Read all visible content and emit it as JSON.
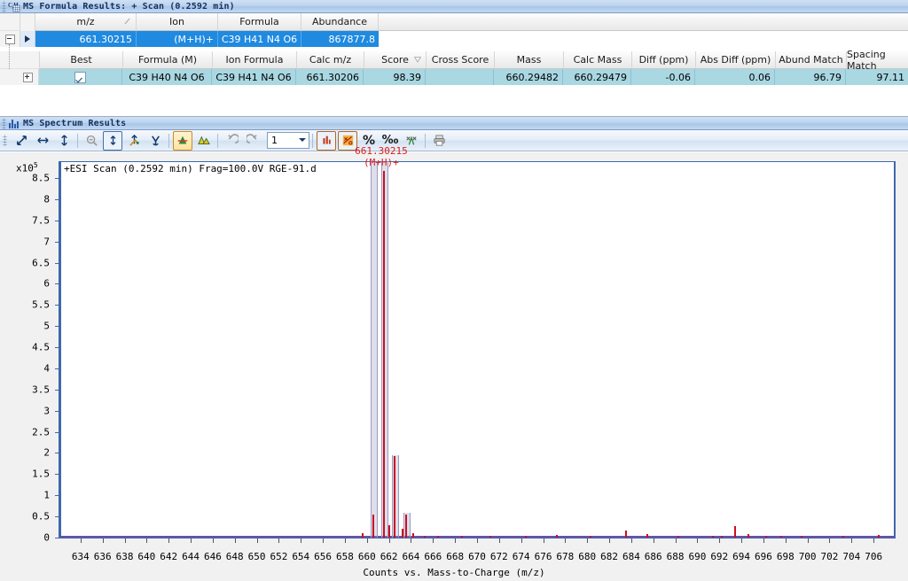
{
  "formula_window": {
    "title": "MS Formula Results: + Scan (0.2592 min)",
    "icon": "molecular-formula-icon",
    "top_grid": {
      "columns": [
        "m/z",
        "Ion",
        "Formula",
        "Abundance"
      ],
      "sort_column": "m/z",
      "rows": [
        {
          "mz": "661.30215",
          "ion": "(M+H)+",
          "formula": "C39 H41 N4 O6",
          "abundance": "867877.8"
        }
      ]
    },
    "detail_grid": {
      "columns": [
        "Best",
        "Formula (M)",
        "Ion Formula",
        "Calc m/z",
        "Score",
        "Cross Score",
        "Mass",
        "Calc Mass",
        "Diff (ppm)",
        "Abs Diff (ppm)",
        "Abund Match",
        "Spacing Match"
      ],
      "sort_column": "Score",
      "rows": [
        {
          "best": "checked",
          "formula_m": "C39 H40 N4 O6",
          "ion_formula": "C39 H41 N4 O6",
          "calc_mz": "661.30206",
          "score": "98.39",
          "cross_score": "",
          "mass": "660.29482",
          "calc_mass": "660.29479",
          "diff_ppm": "-0.06",
          "abs_diff_ppm": "0.06",
          "abund_match": "96.79",
          "spacing_match": "97.11"
        }
      ]
    }
  },
  "spectrum_window": {
    "title": "MS Spectrum Results",
    "icon": "bar-chart-icon",
    "toolbar": {
      "buttons": [
        {
          "name": "zoom-both-axes-icon",
          "glyph": "⤡"
        },
        {
          "name": "zoom-x-axis-icon",
          "glyph": "↔"
        },
        {
          "name": "zoom-y-axis-icon",
          "glyph": "↕"
        },
        {
          "name": "zoom-out-icon",
          "glyph": "⊝"
        },
        {
          "name": "autoscale-y-icon",
          "glyph": "↕"
        },
        {
          "name": "manual-scale-icon",
          "glyph": "✎"
        },
        {
          "name": "anchor-scale-icon",
          "glyph": "⚓"
        },
        {
          "name": "overlay-spectra-icon",
          "glyph": "△"
        },
        {
          "name": "mirror-spectra-icon",
          "glyph": "▲"
        },
        {
          "name": "undo-zoom-icon",
          "glyph": "↺"
        },
        {
          "name": "redo-zoom-icon",
          "glyph": "↻"
        },
        {
          "name": "show-peak-labels-icon",
          "glyph": "▐"
        },
        {
          "name": "hide-labels-icon",
          "glyph": "✂"
        },
        {
          "name": "percent-scale-icon",
          "glyph": "%"
        },
        {
          "name": "percent-relative-icon",
          "glyph": "‰"
        },
        {
          "name": "extract-peaks-icon",
          "glyph": "⛶"
        },
        {
          "name": "print-icon",
          "glyph": "⎙"
        }
      ],
      "pane_count_value": "1"
    },
    "chart_data": {
      "type": "line",
      "title": "+ESI Scan (0.2592 min) Frag=100.0V RGE-91.d",
      "xlabel": "Counts vs. Mass-to-Charge (m/z)",
      "ylabel": "",
      "y_units": "x10",
      "y_units_exponent": "5",
      "xlim": [
        632,
        708
      ],
      "ylim": [
        0,
        8.9
      ],
      "xticks": [
        634,
        636,
        638,
        640,
        642,
        644,
        646,
        648,
        650,
        652,
        654,
        656,
        658,
        660,
        662,
        664,
        666,
        668,
        670,
        672,
        674,
        676,
        678,
        680,
        682,
        684,
        686,
        688,
        690,
        692,
        694,
        696,
        698,
        700,
        702,
        704,
        706
      ],
      "yticks": [
        0,
        0.5,
        1,
        1.5,
        2,
        2.5,
        3,
        3.5,
        4,
        4.5,
        5,
        5.5,
        6,
        6.5,
        7,
        7.5,
        8,
        8.5
      ],
      "ytick_labels": [
        "0",
        "0.5",
        "1",
        "1.5",
        "2",
        "2.5",
        "3",
        "3.5",
        "4",
        "4.5",
        "5",
        "5.5",
        "6",
        "6.5",
        "7",
        "7.5",
        "8",
        "8.5"
      ],
      "grid": false,
      "annotations": [
        {
          "text": "661.30215",
          "subtext": "(M+H)+",
          "x": 661.3,
          "y": 8.7,
          "color": "#e01b1b"
        }
      ],
      "peaks": [
        {
          "x": 659.4,
          "y": 0.1
        },
        {
          "x": 660.3,
          "y": 0.55
        },
        {
          "x": 661.3,
          "y": 8.68
        },
        {
          "x": 661.8,
          "y": 0.3
        },
        {
          "x": 662.3,
          "y": 1.92
        },
        {
          "x": 663.0,
          "y": 0.22
        },
        {
          "x": 663.3,
          "y": 0.55
        },
        {
          "x": 664.0,
          "y": 0.1
        },
        {
          "x": 665.0,
          "y": 0.05
        },
        {
          "x": 666.2,
          "y": 0.04
        },
        {
          "x": 668.4,
          "y": 0.04
        },
        {
          "x": 671.0,
          "y": 0.05
        },
        {
          "x": 674.2,
          "y": 0.05
        },
        {
          "x": 677.0,
          "y": 0.06
        },
        {
          "x": 680.1,
          "y": 0.05
        },
        {
          "x": 683.3,
          "y": 0.17
        },
        {
          "x": 685.2,
          "y": 0.09
        },
        {
          "x": 688.0,
          "y": 0.04
        },
        {
          "x": 691.2,
          "y": 0.05
        },
        {
          "x": 692.0,
          "y": 0.05
        },
        {
          "x": 693.2,
          "y": 0.27
        },
        {
          "x": 694.4,
          "y": 0.09
        },
        {
          "x": 696.0,
          "y": 0.05
        },
        {
          "x": 697.4,
          "y": 0.04
        },
        {
          "x": 699.2,
          "y": 0.05
        },
        {
          "x": 703.0,
          "y": 0.05
        },
        {
          "x": 706.2,
          "y": 0.06
        }
      ],
      "isotope_bands": [
        {
          "x": 660.3,
          "y": 8.9
        },
        {
          "x": 661.3,
          "y": 8.9
        },
        {
          "x": 662.3,
          "y": 1.95
        },
        {
          "x": 663.3,
          "y": 0.58
        }
      ]
    }
  }
}
